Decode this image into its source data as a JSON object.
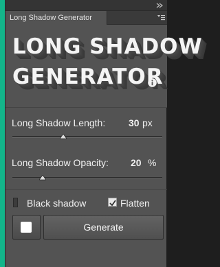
{
  "panel": {
    "tab_label": "Long Shadow Generator",
    "title_line1": "LONG SHADOW",
    "title_line2": "GENERATOR"
  },
  "length": {
    "label": "Long Shadow Length:",
    "value": "30",
    "unit": "px",
    "slider_fraction": 0.34
  },
  "opacity": {
    "label": "Long Shadow Opacity:",
    "value": "20",
    "unit": "%",
    "slider_fraction": 0.2
  },
  "options": {
    "black_shadow_label": "Black shadow",
    "black_shadow_checked": false,
    "flatten_label": "Flatten",
    "flatten_checked": true
  },
  "actions": {
    "generate_label": "Generate",
    "swatch_color": "#ffffff"
  },
  "colors": {
    "accent": "#13b58a",
    "panel_bg": "#535353"
  }
}
